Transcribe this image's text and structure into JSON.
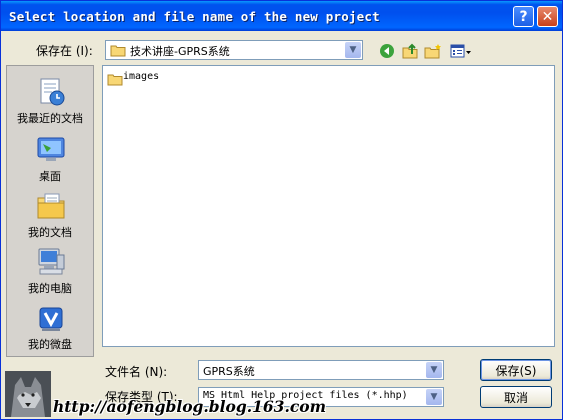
{
  "window": {
    "title": "Select location and file name of the new project",
    "help_button": "?",
    "close_button": "✕"
  },
  "location": {
    "label": "保存在 (I):",
    "value": "技术讲座-GPRS系统"
  },
  "places": [
    {
      "label": "我最近的文档",
      "icon": "recent-documents-icon"
    },
    {
      "label": "桌面",
      "icon": "desktop-icon"
    },
    {
      "label": "我的文档",
      "icon": "my-documents-icon"
    },
    {
      "label": "我的电脑",
      "icon": "my-computer-icon"
    },
    {
      "label": "我的微盘",
      "icon": "my-network-places-icon"
    }
  ],
  "files": [
    {
      "name": "images",
      "icon": "folder-icon"
    }
  ],
  "filename": {
    "label": "文件名 (N):",
    "value": "GPRS系统"
  },
  "filetype": {
    "label": "保存类型 (T):",
    "value": "MS Html Help project files (*.hhp)"
  },
  "buttons": {
    "save": "保存(S)",
    "cancel": "取消"
  },
  "watermark": "http://aofengblog.blog.163.com",
  "colors": {
    "title_bar": "#0053ee",
    "dialog_bg": "#ece9d8",
    "places_bg": "#d6d3ce",
    "close_button": "#c8401c"
  }
}
